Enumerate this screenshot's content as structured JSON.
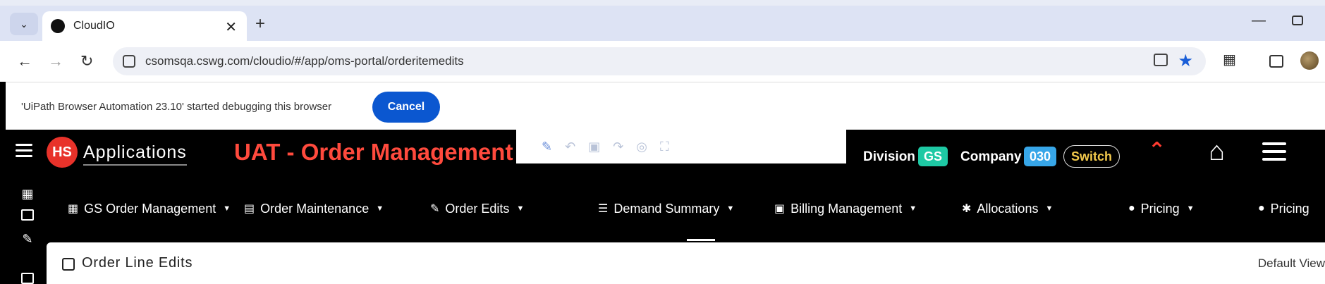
{
  "browser": {
    "tab_title": "CloudIO",
    "url": "csomsqa.cswg.com/cloudio/#/app/oms-portal/orderitemedits"
  },
  "infobar": {
    "message": "'UiPath Browser Automation 23.10' started debugging this browser",
    "cancel_label": "Cancel"
  },
  "header": {
    "logo_text": "Applications",
    "app_title": "UAT - Order Management",
    "division_label": "Division",
    "division_value": "GS",
    "company_label": "Company",
    "company_value": "030",
    "switch_label": "Switch"
  },
  "nav": {
    "items": [
      {
        "label": "GS Order Management",
        "icon": "grid-icon"
      },
      {
        "label": "Order Maintenance",
        "icon": "document-icon"
      },
      {
        "label": "Order Edits",
        "icon": "edit-icon"
      },
      {
        "label": "Demand Summary",
        "icon": "list-icon"
      },
      {
        "label": "Billing Management",
        "icon": "card-icon"
      },
      {
        "label": "Allocations",
        "icon": "asterisk-icon"
      },
      {
        "label": "Pricing",
        "icon": "dollar-icon"
      },
      {
        "label": "Pricing",
        "icon": "dollar-icon"
      }
    ]
  },
  "content": {
    "heading": "Order Line Edits",
    "view_label": "Default View"
  },
  "colors": {
    "title_red": "#ff4a3d",
    "division_badge": "#1ec9a4",
    "company_badge": "#37a6e8",
    "switch_text": "#f2c94c",
    "cancel_blue": "#0b57d0"
  }
}
